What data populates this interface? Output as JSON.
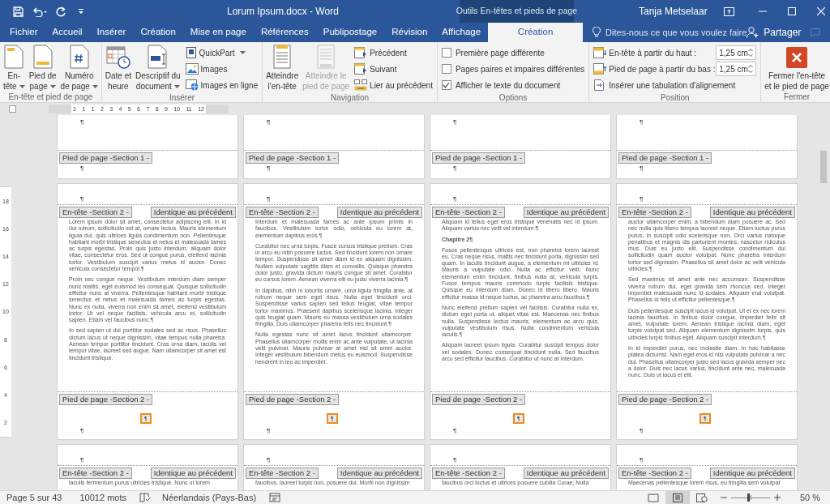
{
  "window": {
    "title": "Lorum Ipsum.docx - Word",
    "context_label": "Outils En-têtes et pieds de page",
    "user": "Tanja Metselaar"
  },
  "tabs": [
    {
      "label": "Fichier",
      "selected": false
    },
    {
      "label": "Accueil",
      "selected": false
    },
    {
      "label": "Insérer",
      "selected": false
    },
    {
      "label": "Création",
      "selected": false
    },
    {
      "label": "Mise en page",
      "selected": false
    },
    {
      "label": "Références",
      "selected": false
    },
    {
      "label": "Publipostage",
      "selected": false
    },
    {
      "label": "Révision",
      "selected": false
    },
    {
      "label": "Affichage",
      "selected": false
    },
    {
      "label": "Création",
      "selected": true
    }
  ],
  "tell_me": {
    "placeholder": "Dites-nous ce que vous voulez faire"
  },
  "share": "Partager",
  "ribbon": {
    "groups": [
      {
        "label": "En-tête et pied de page",
        "items": [
          {
            "kind": "large",
            "label": "En-\ntête",
            "dropdown": true,
            "disabled": false
          },
          {
            "kind": "large",
            "label": "Pied de\npage",
            "dropdown": true,
            "disabled": false
          },
          {
            "kind": "large",
            "label": "Numéro\nde page",
            "dropdown": true,
            "disabled": false
          }
        ]
      },
      {
        "label": "Insérer",
        "items": [
          {
            "kind": "large",
            "label": "Date et\nheure",
            "dropdown": false,
            "disabled": false
          },
          {
            "kind": "large",
            "label": "Descriptif du\ndocument",
            "dropdown": true,
            "disabled": false
          },
          {
            "kind": "stack",
            "items": [
              {
                "kind": "small",
                "label": "QuickPart",
                "dropdown": true
              },
              {
                "kind": "small",
                "label": "Images",
                "dropdown": false
              },
              {
                "kind": "small",
                "label": "Images en ligne",
                "dropdown": false
              }
            ]
          }
        ]
      },
      {
        "label": "Navigation",
        "items": [
          {
            "kind": "large",
            "label": "Atteindre\nl'en-tête",
            "dropdown": false,
            "disabled": false
          },
          {
            "kind": "large",
            "label": "Atteindre le\npied de page",
            "dropdown": false,
            "disabled": true
          },
          {
            "kind": "stack",
            "items": [
              {
                "kind": "small",
                "label": "Précédent",
                "dropdown": false
              },
              {
                "kind": "small",
                "label": "Suivant",
                "dropdown": false
              },
              {
                "kind": "small",
                "label": "Lier au précédent",
                "dropdown": false
              }
            ]
          }
        ]
      },
      {
        "label": "Options",
        "items": [
          {
            "kind": "stack",
            "items": [
              {
                "kind": "checkbox",
                "label": "Première page différente",
                "checked": false
              },
              {
                "kind": "checkbox",
                "label": "Pages paires et impaires différentes",
                "checked": false
              },
              {
                "kind": "checkbox",
                "label": "Afficher le texte du document",
                "checked": true
              }
            ]
          }
        ]
      },
      {
        "label": "Position",
        "items": [
          {
            "kind": "stack",
            "items": [
              {
                "kind": "spin",
                "label": "En-tête à partir du haut :",
                "value": "1,25 cm"
              },
              {
                "kind": "spin",
                "label": "Pied de page à partir du bas :",
                "value": "1,25 cm"
              },
              {
                "kind": "small",
                "label": "Insérer une tabulation d'alignement",
                "dropdown": false
              }
            ]
          }
        ]
      },
      {
        "label": "Fermer",
        "items": [
          {
            "kind": "large",
            "label": "Fermer l'en-tête\net le pied de page",
            "dropdown": false,
            "disabled": false
          }
        ]
      }
    ]
  },
  "ruler": {
    "h_ticks": [
      "2",
      "1",
      "1",
      "2",
      "3",
      "4",
      "5",
      "6",
      "7",
      "8",
      "9",
      "10",
      "11",
      "12"
    ],
    "v_ticks": [
      "18",
      "16",
      "14",
      "12",
      "10",
      "8",
      "6",
      "4",
      "2"
    ]
  },
  "document": {
    "rows": [
      {
        "pages": [
          {
            "blocks": [
              {
                "kind": "mark",
                "text": "¶"
              },
              {
                "kind": "footer_bar",
                "label": "Pied de page -Section 1 -"
              },
              {
                "kind": "mark",
                "text": "¶"
              }
            ]
          },
          {
            "blocks": [
              {
                "kind": "mark",
                "text": "¶"
              },
              {
                "kind": "footer_bar",
                "label": "Pied de page -Section 1 -"
              },
              {
                "kind": "mark",
                "text": "¶"
              }
            ]
          },
          {
            "blocks": [
              {
                "kind": "mark",
                "text": "¶"
              },
              {
                "kind": "footer_bar",
                "label": "Pied de page -Section 1 -"
              },
              {
                "kind": "mark",
                "text": "¶"
              }
            ]
          },
          {
            "blocks": [
              {
                "kind": "mark",
                "text": "¶"
              },
              {
                "kind": "footer_bar",
                "label": "Pied de page -Section 1 -"
              },
              {
                "kind": "mark",
                "text": "¶"
              }
            ]
          }
        ]
      },
      {
        "pages": [
          {
            "blocks": [
              {
                "kind": "mark",
                "text": "¶"
              },
              {
                "kind": "header_bar",
                "label": "En-tête -Section 2 -",
                "link_label": "Identique au précédent"
              },
              {
                "kind": "para",
                "text": "Lorem ipsum dolor sit amet, consectetur adipiscing elit. In id dui rutrum, sollicitudin est at, ornare lectus. Mauris elementum ligula dui, quis ultrices ligula condimentum non. Pellentesque habitant morbi tristique senectus et netus et malesuada fames ac turpis egestas. Proin quis justo interdum, aliquam dolor vitae, consectetur eros. Sed ut congue purus, eleifend lacinia tortor. Vestibulum suscipit varius metus id auctor. Donec vehicula consectetur tempor.¶"
              },
              {
                "kind": "para",
                "text": "Proin nec congue neque. Vestibulum interdum diam semper nunc mattis, eget euismod leo consequat. Quisque sollicitudin efficitur nunc at viverra. Pellentesque habitant morbi tristique senectus et netus et malesuada fames ac turpis egestas. Nunc ex nulla, viverra non enim sit amet, eleifend vestibulum tortor. Ut vel neque facilisis, vehicula arcu et, sollicitudin sapien. Etiam vel faucibus nunc.¶"
              },
              {
                "kind": "para",
                "text": "In sed sapien ut dui porttitor sodales sed ac risus. Phasellus dictum lacus ut neque dignissim, vitae tempus nulla pharetra. Aenean tempor porttitor tincidunt. Cras urna diam, iaculis vel tempor vitae, laoreet sed augue. Nam ullamcorper sit amet est tincidunt tristique."
              },
              {
                "kind": "footer_bar",
                "label": "Pied de page -Section 2 -"
              },
              {
                "kind": "field",
                "text": "¶"
              },
              {
                "kind": "mark",
                "text": "¶"
              }
            ]
          },
          {
            "blocks": [
              {
                "kind": "mark",
                "text": "¶"
              },
              {
                "kind": "header_bar",
                "label": "En-tête -Section 2 -",
                "link_label": "Identique au précédent"
              },
              {
                "kind": "para",
                "text": "Interdum et malesuada fames ac ante ipsum primis in faucibus. Vestibulum tortor odio, vehicula eu lorem at, elementum dapibus eros.¶"
              },
              {
                "kind": "para",
                "text": "Curabitur nec urna turpis. Fusce cursus tristique pretium. Cras in arcu eu nibh posuere luctus. Sed tincidunt lorem non ornare tempor. Suspendisse sit amet diam id ex aliquam dignissim. Nullam vulputate sagittis diam et convallis. Quisque pharetra dolor justo, gravida dictum mauris congue sit amet. Curabitur eu cursus lorem. Aenean viverra elit eu justo viverra lacinia.¶"
              },
              {
                "kind": "para",
                "text": "In dapibus, nibh in lobortis ornare, urna ligula fringilla ante, at rutrum neque sem eget risus. Nulla eget tincidunt orci. Suspendisse varius sapien sed tellus feugiat, vitae tempor tortor maximus. Praesent dapibus scelerisque lacinia. Integer quis feugiat quam. Mauris eu massa vestibulum urna sodales fringilla. Duis ullamcorper pharetra felis nec tincidunt.¶"
              },
              {
                "kind": "para",
                "text": "Nulla egestas nunc sit amet lacus tincidunt ullamcorper. Phasellus ullamcorper mollis enim ac ante vulputate, ut lacinia velit pulvinar. Mauris pulvinar at amet nisl sit amet auctor. Integer vestibulum bibendum metus eu euismod. Suspendisse hendrerit in leo ac imperdiet."
              },
              {
                "kind": "footer_bar",
                "label": "Pied de page -Section 2 -"
              },
              {
                "kind": "field",
                "text": "¶"
              },
              {
                "kind": "mark",
                "text": "¶"
              }
            ]
          },
          {
            "blocks": [
              {
                "kind": "mark",
                "text": "¶"
              },
              {
                "kind": "header_bar",
                "label": "En-tête -Section 2 -",
                "link_label": "Identique au précédent"
              },
              {
                "kind": "para",
                "text": "Aliquam id tellus eget eros tristique venenatis nec id ipsum. Aliquam varius nec velit vel interdum.¶"
              },
              {
                "kind": "heading",
                "text": "Chapitre 2¶"
              },
              {
                "kind": "para",
                "text": "Fusce pellentesque ultrices est, non pharetra lorem laoreet eu. Cras neque risus, mattis nec tincidunt porta, dignissim sed quam. In iaculis tincidunt augue, a elementum mi ultricies id. Mauris a vulputate odio. Nulla ac efficitur velit. Nunc elementum enim tincidunt, finibus nulla at, vehicula turpis. Fusce tempus mauris commodo turpis facilisis tristique. Quisque eu interdum diam. Donec id libero libero. Mauris efficitur massa id neque luctus, ac pharetra arcu faucibus.¶"
              },
              {
                "kind": "para",
                "text": "Nunc eleifend pretium sapien vel facilisis. Curabitur nulla ex, dictum eget porta ut, aliquet vitae est. Maecenas nec finibus nulla. Suspendisse lectus mauris, elementum ac arcu quis, vulputate vestibulum risus. Nulla condimentum vehicula iaculis.¶"
              },
              {
                "kind": "para",
                "text": "Aliquam laoreet ipsum ligula. Curabitur suscipit tempus dolor vel sodales. Donec consequat tincidunt nulla. Sed faucibus arcu sed efficitur faucibus. Curabitur ut nunc at interdum."
              },
              {
                "kind": "footer_bar",
                "label": "Pied de page -Section 2 -"
              },
              {
                "kind": "field",
                "text": "¶"
              },
              {
                "kind": "mark",
                "text": "¶"
              }
            ]
          },
          {
            "blocks": [
              {
                "kind": "mark",
                "text": "¶"
              },
              {
                "kind": "header_bar",
                "label": "En-tête -Section 2 -",
                "link_label": "Identique au précédent"
              },
              {
                "kind": "para",
                "text": "auctor ullamcorper enim, a bibendum diam posuere ac. Sed nec nulla quis libero tempus laoreet neque. Etiam luctus purus purus, in suscipit odio scelerisque non. Orci varius natoque penatibus et magnis dis parturient montes, nascetur ridiculus mus. Duis eu justo elit. Suspendisse condimentum dui sollicitudin quam auctor volutpat. Nunc pharetra interdum tortor sed dignissim. Phasellus sit amet dolor ac velit vehicula ultricies.¶"
              },
              {
                "kind": "para",
                "text": "Sed maximus sit amet ante nec accumsan. Suspendisse viverra rutrum dui, eget gravida sem rhoncus sed. Integer imperdiet malesuada nunc id sodales. Aliquam erat volutpat. Phasellus id felis ut efficitur pellentesque.¶"
              },
              {
                "kind": "para",
                "text": "Duis pellentesque suscipit lacus id volutpat. Ut et ex nec lorem lacinia faucibus. In finibus dolor congue, imperdiet felis sit amet, vulputate lorem. Aenean tristique lacinia diam, eget turpis volutpat sed. Aliquam elementum dignissim turpis, quis ultricies turpis finibus eget. Aliquam suscipit interdum.¶"
              },
              {
                "kind": "para",
                "text": "In id imperdiet purus, nec molestie diam. In hac habitasse platea dictumst. Nam eget eros id nisl vulputate pulvinar a nec dui. Phasellus ullamcorper justo sed lacus gravida semper nec a dolor. Duis nec lacus varius, tincidunt ante nec, malesuada nunc. Duis ut lacus et elit."
              },
              {
                "kind": "footer_bar",
                "label": "Pied de page -Section 2 -"
              },
              {
                "kind": "field",
                "text": "¶"
              },
              {
                "kind": "mark",
                "text": "¶"
              }
            ]
          }
        ]
      },
      {
        "pages": [
          {
            "blocks": [
              {
                "kind": "mark",
                "text": "¶"
              },
              {
                "kind": "header_bar",
                "label": "En-tête -Section 2 -",
                "link_label": "Identique au précédent"
              },
              {
                "kind": "para",
                "text": "iaculis fermentum purus ultricies tristique. Nunc ut lorem"
              }
            ]
          },
          {
            "blocks": [
              {
                "kind": "mark",
                "text": "¶"
              },
              {
                "kind": "header_bar",
                "label": "En-tête -Section 2 -",
                "link_label": "Identique au précédent"
              },
              {
                "kind": "para",
                "text": "faucibus, laoreet turpis non, posuere dui. Morbi non dignissim"
              }
            ]
          },
          {
            "blocks": [
              {
                "kind": "mark",
                "text": "¶"
              },
              {
                "kind": "header_bar",
                "label": "En-tête -Section 2 -",
                "link_label": "Identique au précédent"
              },
              {
                "kind": "para",
                "text": "faucibus orci luctus et ultrices posuere cubilia Curae; Nulla"
              }
            ]
          },
          {
            "blocks": [
              {
                "kind": "mark",
                "text": "¶"
              },
              {
                "kind": "header_bar",
                "label": "En-tête -Section 2 -",
                "link_label": "Identique au précédent"
              },
              {
                "kind": "para",
                "text": "Maecenas pellentesque lorem risus, eu fringilla sem volutpat"
              }
            ]
          }
        ]
      }
    ]
  },
  "status_bar": {
    "page": "Page 5 sur 43",
    "words": "10012 mots",
    "language": "Néerlandais (Pays-Bas)",
    "views": [
      {
        "selected": false
      },
      {
        "selected": true
      },
      {
        "selected": false
      }
    ],
    "zoom": {
      "level": 0.44,
      "reading": "50 %"
    }
  }
}
